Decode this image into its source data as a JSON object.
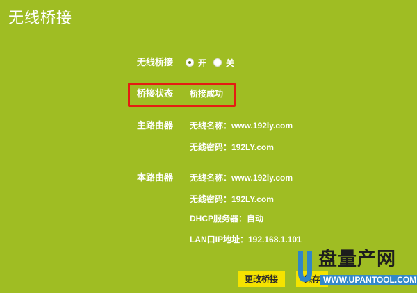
{
  "header": {
    "title": "无线桥接"
  },
  "bridge": {
    "label": "无线桥接",
    "option_on": "开",
    "option_off": "关",
    "selected": "开"
  },
  "status": {
    "label": "桥接状态",
    "value": "桥接成功"
  },
  "main_router": {
    "label": "主路由器",
    "ssid": "无线名称：www.192ly.com",
    "password": "无线密码：192LY.com"
  },
  "local_router": {
    "label": "本路由器",
    "ssid": "无线名称：www.192ly.com",
    "password": "无线密码：192LY.com",
    "dhcp": "DHCP服务器：自动",
    "lan_ip": "LAN口IP地址：192.168.1.101"
  },
  "actions": {
    "modify_label": "更改桥接",
    "save_label": "保存"
  },
  "watermark": {
    "text": "盘量产网",
    "url": "WWW.UPANTOOL.COM"
  },
  "colors": {
    "background": "#9fbd23",
    "button": "#f5e300",
    "highlight": "#e41c12",
    "watermark_blue": "#3288c9"
  },
  "icons": {
    "radio_on": "radio-selected-icon",
    "radio_off": "radio-unselected-icon",
    "watermark_logo": "u-logo-icon"
  }
}
